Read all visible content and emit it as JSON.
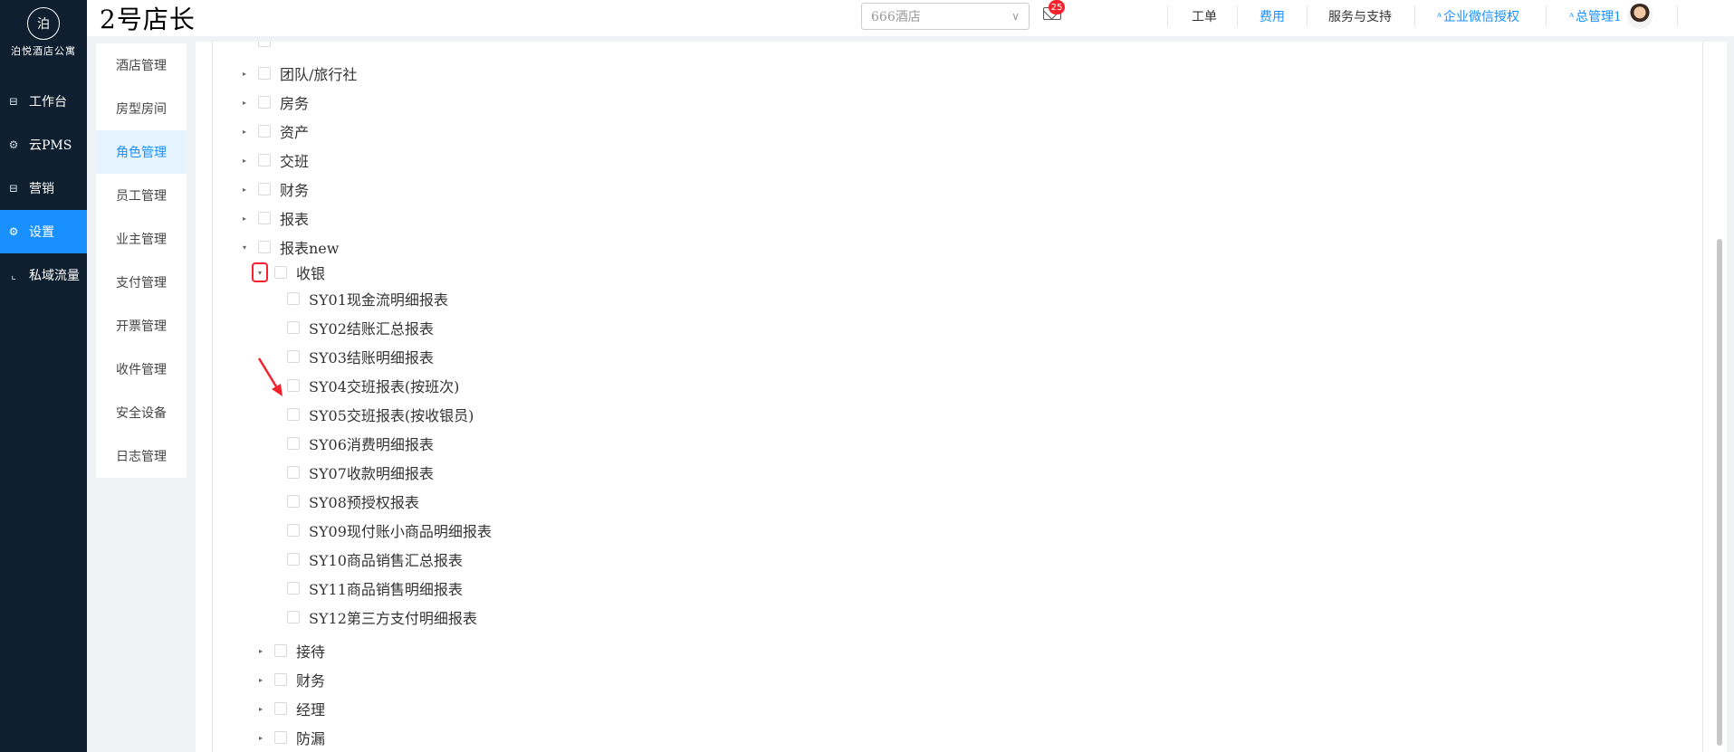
{
  "sidebar": {
    "logo_mark": "泊",
    "logo_text": "泊悦酒店公寓",
    "items": [
      {
        "label": "工作台",
        "icon": "workbench-icon"
      },
      {
        "label": "云PMS",
        "icon": "gear-icon"
      },
      {
        "label": "营销",
        "icon": "marketing-icon"
      },
      {
        "label": "设置",
        "icon": "settings-icon",
        "active": true
      },
      {
        "label": "私域流量",
        "icon": "chart-icon"
      }
    ]
  },
  "header": {
    "brand": "2号店长",
    "hotel_select": "666酒店",
    "mail_badge": "25",
    "nav": [
      "工单",
      "费用",
      "服务与支持",
      "企业微信授权",
      "总管理1"
    ]
  },
  "submenu": {
    "items": [
      "酒店管理",
      "房型房间",
      "角色管理",
      "员工管理",
      "业主管理",
      "支付管理",
      "开票管理",
      "收件管理",
      "安全设备",
      "日志管理"
    ],
    "active_index": 2
  },
  "tree": {
    "top_level": [
      "团队/旅行社",
      "房务",
      "资产",
      "交班",
      "财务",
      "报表",
      "报表new"
    ],
    "expanded_group": "收银",
    "leaves": [
      "SY01现金流明细报表",
      "SY02结账汇总报表",
      "SY03结账明细报表",
      "SY04交班报表(按班次)",
      "SY05交班报表(按收银员)",
      "SY06消费明细报表",
      "SY07收款明细报表",
      "SY08预授权报表",
      "SY09现付账小商品明细报表",
      "SY10商品销售汇总报表",
      "SY11商品销售明细报表",
      "SY12第三方支付明细报表"
    ],
    "sub_groups": [
      "接待",
      "财务",
      "经理",
      "防漏"
    ]
  },
  "colors": {
    "accent": "#1890ff",
    "sidebar_bg": "#0f1f2f",
    "highlight": "#f5222d"
  }
}
